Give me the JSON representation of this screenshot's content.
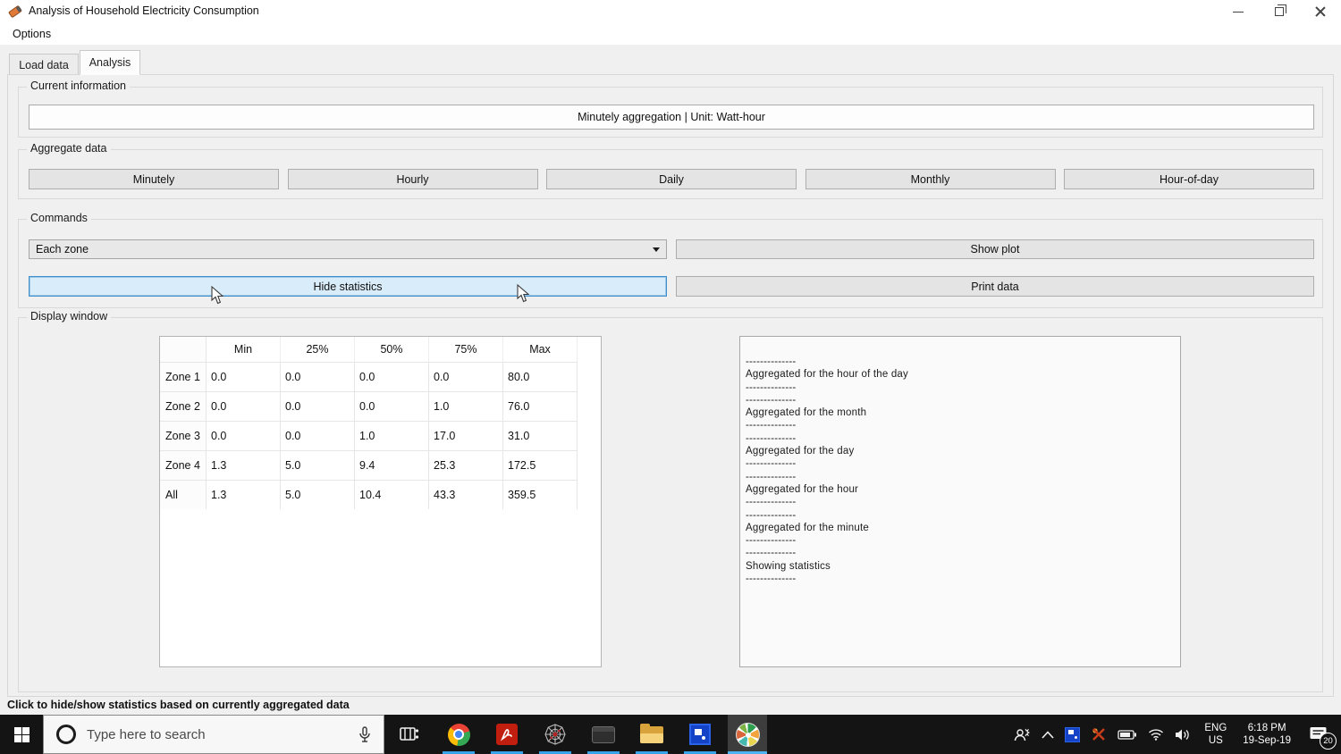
{
  "window": {
    "title": "Analysis of Household Electricity Consumption",
    "app_icon": "orange-tag-icon",
    "controls": {
      "minimize": "minimize",
      "restore": "restore",
      "close": "close"
    }
  },
  "menu_bar": {
    "items": [
      {
        "label": "Options"
      }
    ]
  },
  "tabs": {
    "items": [
      {
        "label": "Load data",
        "active": false
      },
      {
        "label": "Analysis",
        "active": true
      }
    ]
  },
  "current_information": {
    "group_label": "Current information",
    "value": "Minutely aggregation | Unit: Watt-hour"
  },
  "aggregate_data": {
    "group_label": "Aggregate data",
    "buttons": [
      "Minutely",
      "Hourly",
      "Daily",
      "Monthly",
      "Hour-of-day"
    ]
  },
  "commands": {
    "group_label": "Commands",
    "zone_dropdown_value": "Each zone",
    "show_plot_label": "Show plot",
    "hide_statistics_label": "Hide statistics",
    "print_data_label": "Print data"
  },
  "display_window": {
    "group_label": "Display window",
    "statistics_table": {
      "columns": [
        "Min",
        "25%",
        "50%",
        "75%",
        "Max"
      ],
      "rows": [
        {
          "name": "Zone 1",
          "values": [
            "0.0",
            "0.0",
            "0.0",
            "0.0",
            "80.0"
          ]
        },
        {
          "name": "Zone 2",
          "values": [
            "0.0",
            "0.0",
            "0.0",
            "1.0",
            "76.0"
          ]
        },
        {
          "name": "Zone 3",
          "values": [
            "0.0",
            "0.0",
            "1.0",
            "17.0",
            "31.0"
          ]
        },
        {
          "name": "Zone 4",
          "values": [
            "1.3",
            "5.0",
            "9.4",
            "25.3",
            "172.5"
          ]
        },
        {
          "name": "All",
          "values": [
            "1.3",
            "5.0",
            "10.4",
            "43.3",
            "359.5"
          ]
        }
      ]
    },
    "log_lines": [
      "--------------",
      "Aggregated for the hour of the day",
      "--------------",
      "--------------",
      "Aggregated for the month",
      "--------------",
      "--------------",
      "Aggregated for the day",
      "--------------",
      "--------------",
      "Aggregated for the hour",
      "--------------",
      "--------------",
      "Aggregated for the minute",
      "--------------",
      "--------------",
      "Showing statistics",
      "--------------"
    ]
  },
  "status_bar": {
    "text": "Click to hide/show statistics based on currently aggregated data"
  },
  "taskbar": {
    "search": {
      "placeholder": "Type here to search"
    },
    "app_icons": [
      "task-view",
      "chrome",
      "acrobat-pdf",
      "web-framework",
      "terminal",
      "file-explorer",
      "remote-desktop",
      "analysis-app-active"
    ],
    "tray": {
      "language": "ENG",
      "region": "US",
      "time": "6:18 PM",
      "date": "19-Sep-19",
      "notification_count": "20"
    }
  },
  "colors": {
    "highlight_border": "#3f8fcc",
    "highlight_fill": "#d9ecf9",
    "taskbar_underline": "#38a3e8",
    "titlebar_bg": "#ffffff",
    "window_bg": "#f0f0f0",
    "taskbar_bg": "#141414"
  }
}
